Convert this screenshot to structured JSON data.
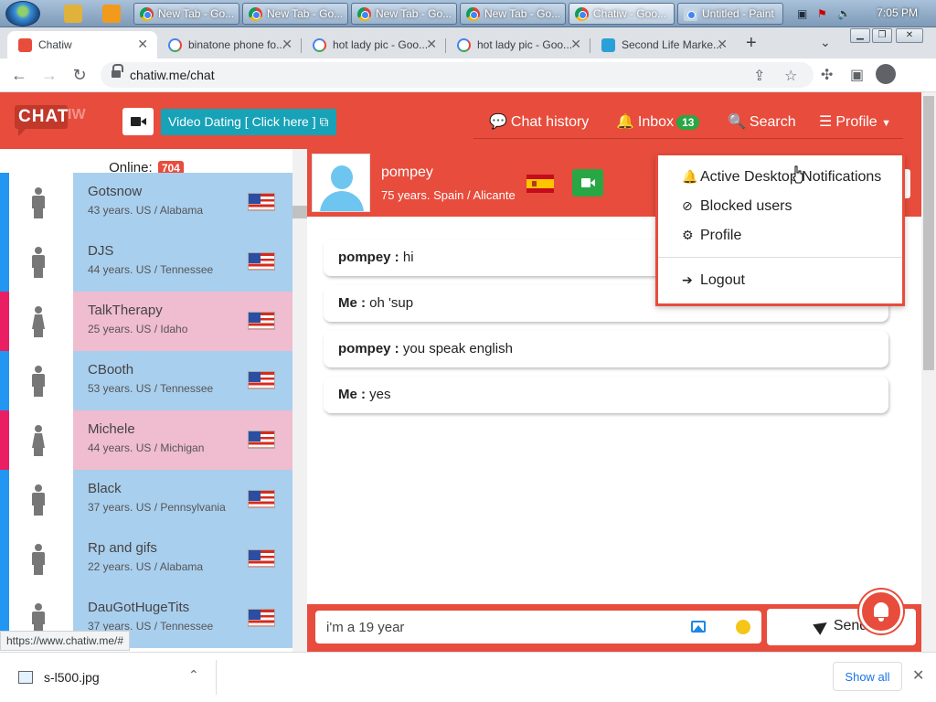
{
  "taskbar": {
    "tasks": [
      {
        "label": "New Tab - Go..."
      },
      {
        "label": "New Tab - Go..."
      },
      {
        "label": "New Tab - Go..."
      },
      {
        "label": "New Tab - Go..."
      },
      {
        "label": "Chatiw - Goo..."
      },
      {
        "label": "Untitled - Paint"
      }
    ],
    "clock": "7:05 PM"
  },
  "browser": {
    "tabs": [
      {
        "label": "Chatiw",
        "favicon": "chatiw-icon",
        "active": true
      },
      {
        "label": "binatone phone fo...",
        "favicon": "google-icon"
      },
      {
        "label": "hot lady pic - Goo...",
        "favicon": "google-icon"
      },
      {
        "label": "hot lady pic - Goo...",
        "favicon": "google-icon"
      },
      {
        "label": "Second Life Marke...",
        "favicon": "second-life-icon"
      }
    ],
    "url": "chatiw.me/chat"
  },
  "site": {
    "logo_main": "CHAT",
    "logo_suffix": "IW",
    "video_dating_label": "Video Dating [ Click here ]",
    "nav": {
      "chat_history": "Chat history",
      "inbox": "Inbox",
      "inbox_count": "13",
      "search": "Search",
      "profile": "Profile"
    },
    "accent_color": "#e74c3c"
  },
  "users_panel": {
    "online_label": "Online:",
    "online_count": "704",
    "users": [
      {
        "name": "Gotsnow",
        "meta": "43 years. US / Alabama",
        "gender": "male"
      },
      {
        "name": "DJS",
        "meta": "44 years. US / Tennessee",
        "gender": "male"
      },
      {
        "name": "TalkTherapy",
        "meta": "25 years. US / Idaho",
        "gender": "female"
      },
      {
        "name": "CBooth",
        "meta": "53 years. US / Tennessee",
        "gender": "male"
      },
      {
        "name": "Michele",
        "meta": "44 years. US / Michigan",
        "gender": "female"
      },
      {
        "name": "Black",
        "meta": "37 years. US / Pennsylvania",
        "gender": "male"
      },
      {
        "name": "Rp and gifs",
        "meta": "22 years. US / Alabama",
        "gender": "male"
      },
      {
        "name": "DauGotHugeTits",
        "meta": "37 years. US / Tennessee",
        "gender": "male"
      }
    ],
    "status_link": "https://www.chatiw.me/#"
  },
  "chat": {
    "partner_name": "pompey",
    "partner_meta": "75 years. Spain / Alicante",
    "messages": [
      {
        "sender": "pompey :",
        "text": " hi"
      },
      {
        "sender": "Me :",
        "text": " oh 'sup"
      },
      {
        "sender": "pompey :",
        "text": " you speak english"
      },
      {
        "sender": "Me :",
        "text": " yes"
      }
    ],
    "input_value": "i'm a 19 year",
    "send_label": "Send"
  },
  "profile_menu": {
    "items": [
      {
        "label": "Active Desktop Notifications",
        "icon": "bell-icon"
      },
      {
        "label": "Blocked users",
        "icon": "ban-icon"
      },
      {
        "label": "Profile",
        "icon": "gears-icon"
      },
      {
        "label": "Logout",
        "icon": "sign-in-icon"
      }
    ]
  },
  "downloads": {
    "file_name": "s-l500.jpg",
    "show_all": "Show all"
  }
}
